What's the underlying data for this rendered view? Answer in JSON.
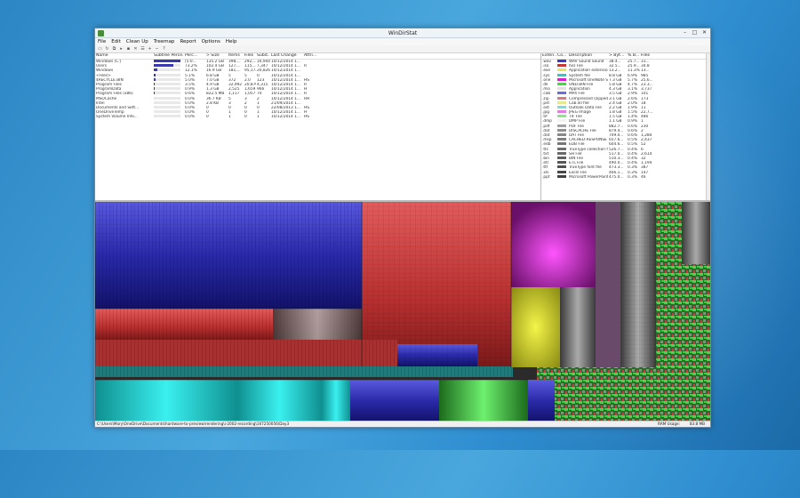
{
  "window": {
    "title": "WinDirStat",
    "controls": [
      "–",
      "□",
      "✕"
    ]
  },
  "menu": [
    "File",
    "Edit",
    "Clean Up",
    "Treemap",
    "Report",
    "Options",
    "Help"
  ],
  "tree": {
    "columns": [
      "Name",
      "Subtree Perce...",
      "Perc...",
      "> Size",
      "Items",
      "Files",
      "Subd...",
      "Last Change",
      "Attri..."
    ],
    "rows": [
      {
        "name": "Windows (C:)",
        "pct": "[5:0...",
        "size": "135.2 GB",
        "items": "398,...",
        "files": "292,...",
        "subd": "16,944",
        "lc": "10/12/2014 1...",
        "attr": "",
        "bar": 100
      },
      {
        "name": "Users",
        "pct": "73.2%",
        "size": "102.4 GB",
        "items": "127,...",
        "files": "115,...",
        "subd": "7,347",
        "lc": "10/12/2014 1...",
        "attr": "R",
        "bar": 73
      },
      {
        "name": "Windows",
        "pct": "12.1%",
        "size": "16.9 GB",
        "items": "181,...",
        "files": "95,173",
        "subd": "20,826",
        "lc": "10/12/2014 1...",
        "attr": "",
        "bar": 12
      },
      {
        "name": "<Files>",
        "pct": "5.1%",
        "size": "6.8 GB",
        "items": "5",
        "files": "5",
        "subd": "0",
        "lc": "10/12/2014 1...",
        "attr": "",
        "bar": 5
      },
      {
        "name": "$RECYCLE.BIN",
        "pct": "5.0%",
        "size": "7.0 GB",
        "items": "372",
        "files": "2.0",
        "subd": "123",
        "lc": "10/12/2014 1...",
        "attr": "HS",
        "bar": 5
      },
      {
        "name": "Program Files",
        "pct": "3.5%",
        "size": "4.9 GB",
        "items": "32,992",
        "files": "20,870",
        "subd": "4,315",
        "lc": "10/12/2014 1...",
        "attr": "R",
        "bar": 3
      },
      {
        "name": "ProgramData",
        "pct": "0.9%",
        "size": "1.3 GB",
        "items": "2,525",
        "files": "1,659",
        "subd": "966",
        "lc": "10/12/2014 1...",
        "attr": "H",
        "bar": 1
      },
      {
        "name": "Program Files (x86)",
        "pct": "0.6%",
        "size": "822.5 MB",
        "items": "1,117",
        "files": "1,057",
        "subd": "70",
        "lc": "10/12/2014 1...",
        "attr": "R",
        "bar": 1
      },
      {
        "name": "MSOCache",
        "pct": "0.0%",
        "size": "36.7 KB",
        "items": "5",
        "files": "3",
        "subd": "2",
        "lc": "10/12/2014 1...",
        "attr": "RH",
        "bar": 0
      },
      {
        "name": "Intel",
        "pct": "0.0%",
        "size": "2.8 KB",
        "items": "3",
        "files": "2",
        "subd": "1",
        "lc": "21/09/2014 1...",
        "attr": "",
        "bar": 0
      },
      {
        "name": "Documents and Sett...",
        "pct": "0.0%",
        "size": "0",
        "items": "0",
        "files": "0",
        "subd": "0",
        "lc": "22/08/2013 1...",
        "attr": "HS",
        "bar": 0
      },
      {
        "name": "OneDriveTemp",
        "pct": "0.0%",
        "size": "0",
        "items": "1",
        "files": "0",
        "subd": "1",
        "lc": "10/12/2014 1...",
        "attr": "H",
        "bar": 0
      },
      {
        "name": "System Volume Info...",
        "pct": "0.0%",
        "size": "0",
        "items": "1",
        "files": "0",
        "subd": "1",
        "lc": "10/12/2014 1...",
        "attr": "HS",
        "bar": 0
      }
    ]
  },
  "extensions": {
    "columns": [
      "Exten...",
      "Co...",
      "Description",
      "> Byt...",
      "% B...",
      "Files"
    ],
    "rows": [
      {
        "ext": ".wav",
        "color": "#3a3acc",
        "desc": "WAV Sound Sound",
        "bytes": "38.4...",
        "pct": "25.7...",
        "files": "31..."
      },
      {
        "ext": ".iso",
        "color": "#c03a3a",
        "desc": "ISO File",
        "bytes": "32.5...",
        "pct": "25.9...",
        "files": "34.8"
      },
      {
        "ext": ".exe",
        "color": "#e5e55c",
        "desc": "Application extension",
        "bytes": "13.2...",
        "pct": "11.3%",
        "files": "13..."
      },
      {
        "ext": ".sys",
        "color": "#37c6c6",
        "desc": "System file",
        "bytes": "8.8 GB",
        "pct": "6.9%",
        "files": "985"
      },
      {
        "ext": ".one",
        "color": "#d21fd2",
        "desc": "Microsoft OneNote Se...",
        "bytes": "7.3 GB",
        "pct": "5.7%",
        "files": "25,6..."
      },
      {
        "ext": ".dll",
        "color": "#3adf3a",
        "desc": "OND.BIN File",
        "bytes": "5.8 GB",
        "pct": "4.7%",
        "files": "23.3..."
      },
      {
        "ext": ".msi",
        "color": "#e0e0e0",
        "desc": "Application",
        "bytes": "4.3 GB",
        "pct": "3.1%",
        "files": "3,737"
      },
      {
        "ext": ".cab",
        "color": "#6b6bdd",
        "desc": "MP4 File",
        "bytes": "3.5 GB",
        "pct": "2.9%",
        "files": "101"
      },
      {
        "ext": ".zip",
        "color": "#d87b7b",
        "desc": "Compressed (zipped)...",
        "bytes": "3.1 GB",
        "pct": "2.6%",
        "files": "173"
      },
      {
        "ext": ".pst",
        "color": "#e8e88f",
        "desc": "Cab.lel file",
        "bytes": "2.4 GB",
        "pct": "2.0%",
        "files": "18"
      },
      {
        "ext": ".ost",
        "color": "#7cdcdc",
        "desc": "Outlook Data File",
        "bytes": "2.2 GB",
        "pct": "1.9%",
        "files": "11"
      },
      {
        "ext": ".jpg",
        "color": "#e37de3",
        "desc": "JPEG Image",
        "bytes": "1.8 GB",
        "pct": "1.5%",
        "files": "22,7..."
      },
      {
        "ext": ".tif",
        "color": "#8be58b",
        "desc": "TIF File",
        "bytes": "1.5 GB",
        "pct": "1.4%",
        "files": "486"
      },
      {
        "ext": ".dmp",
        "color": "#f2f2f2",
        "desc": "DMP File",
        "bytes": "1.1 GB",
        "pct": "0.9%",
        "files": "1"
      },
      {
        "ext": ".pdf",
        "color": "#a0a0a0",
        "desc": "PDF File",
        "bytes": "882.7...",
        "pct": "0.6%",
        "files": "230"
      },
      {
        "ext": ".dat",
        "color": "#909090",
        "desc": "DISCACHE File",
        "bytes": "879.4...",
        "pct": "0.6%",
        "files": "2"
      },
      {
        "ext": ".dat",
        "color": "#888888",
        "desc": "DAT File",
        "bytes": "709.0...",
        "pct": "0.6%",
        "files": "1,280"
      },
      {
        "ext": ".msp",
        "color": "#808080",
        "desc": "CACHED-RESPONSE F...",
        "bytes": "657.6...",
        "pct": "0.5%",
        "files": "2,437"
      },
      {
        "ext": ".edb",
        "color": "#787878",
        "desc": "EDB File",
        "bytes": "604.6...",
        "pct": "0.5%",
        "files": "52"
      },
      {
        "ext": ".ttc",
        "color": "#707070",
        "desc": "TrueType collection fo...",
        "bytes": "526.7...",
        "pct": "0.4%",
        "files": "6"
      },
      {
        "ext": ".txt",
        "color": "#686868",
        "desc": "SH File",
        "bytes": "517.0...",
        "pct": "0.4%",
        "files": "2,614"
      },
      {
        "ext": ".bin",
        "color": "#606060",
        "desc": "BIN File",
        "bytes": "510.3...",
        "pct": "0.4%",
        "files": "32"
      },
      {
        "ext": ".etl",
        "color": "#585858",
        "desc": "ETL File",
        "bytes": "490.0...",
        "pct": "0.4%",
        "files": "1,194"
      },
      {
        "ext": ".ttf",
        "color": "#505050",
        "desc": "TrueType font file",
        "bytes": "473.3...",
        "pct": "0.3%",
        "files": "387"
      },
      {
        "ext": ".xls",
        "color": "#484848",
        "desc": "Excel File",
        "bytes": "466.1...",
        "pct": "0.3%",
        "files": "147"
      },
      {
        "ext": ".ppt",
        "color": "#404040",
        "desc": "Microsoft PowerPoint ...",
        "bytes": "475.0...",
        "pct": "0.3%",
        "files": "46"
      }
    ]
  },
  "status": {
    "path": "C:\\Users\\Mary\\OneDrive\\Documents\\hardware-to-preview\\rendering\\i-2002-recording\\167250056\\Day3",
    "ram_label": "RAM Usage:",
    "ram_value": "83.8 MB"
  }
}
